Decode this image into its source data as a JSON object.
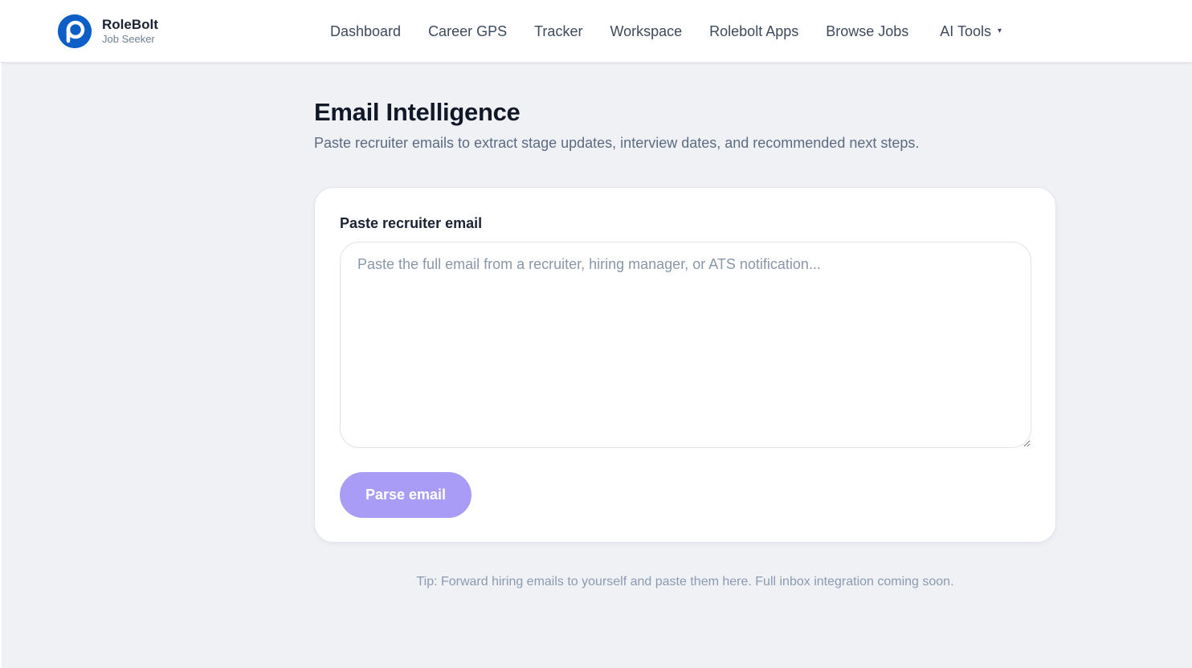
{
  "brand": {
    "name": "RoleBolt",
    "role": "Job Seeker",
    "logo_icon": "p-logo-icon",
    "logo_color": "#0d5fc7"
  },
  "nav": {
    "items": [
      {
        "label": "Dashboard"
      },
      {
        "label": "Career GPS"
      },
      {
        "label": "Tracker"
      },
      {
        "label": "Workspace"
      },
      {
        "label": "Rolebolt Apps"
      },
      {
        "label": "Browse Jobs"
      }
    ],
    "ai_tools": {
      "label": "AI Tools",
      "icon": "caret-down-icon"
    }
  },
  "main": {
    "title": "Email Intelligence",
    "subtitle": "Paste recruiter emails to extract stage updates, interview dates, and recommended next steps.",
    "card": {
      "field_label": "Paste recruiter email",
      "input_value": "",
      "input_placeholder": "Paste the full email from a recruiter, hiring manager, or ATS notification...",
      "parse_button": "Parse email",
      "button_color": "#a99cf6"
    },
    "tip": "Tip: Forward hiring emails to yourself and paste them here. Full inbox integration coming soon."
  }
}
